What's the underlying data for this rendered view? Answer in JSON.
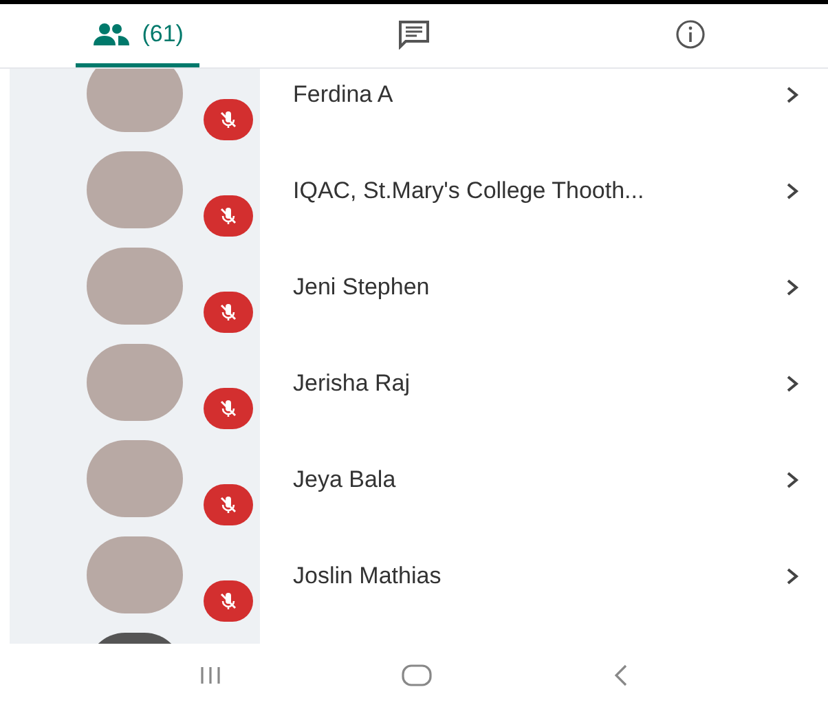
{
  "tabs": [
    {
      "kind": "people",
      "label": "(61)",
      "selected": true
    },
    {
      "kind": "chat",
      "selected": false
    },
    {
      "kind": "info",
      "selected": false
    }
  ],
  "participants": [
    {
      "name": "Ferdina A",
      "muted": true
    },
    {
      "name": "IQAC, St.Mary's College Thooth...",
      "muted": true
    },
    {
      "name": "Jeni Stephen",
      "muted": true
    },
    {
      "name": "Jerisha Raj",
      "muted": true
    },
    {
      "name": "Jeya Bala",
      "muted": true
    },
    {
      "name": "Joslin Mathias",
      "muted": true
    }
  ]
}
